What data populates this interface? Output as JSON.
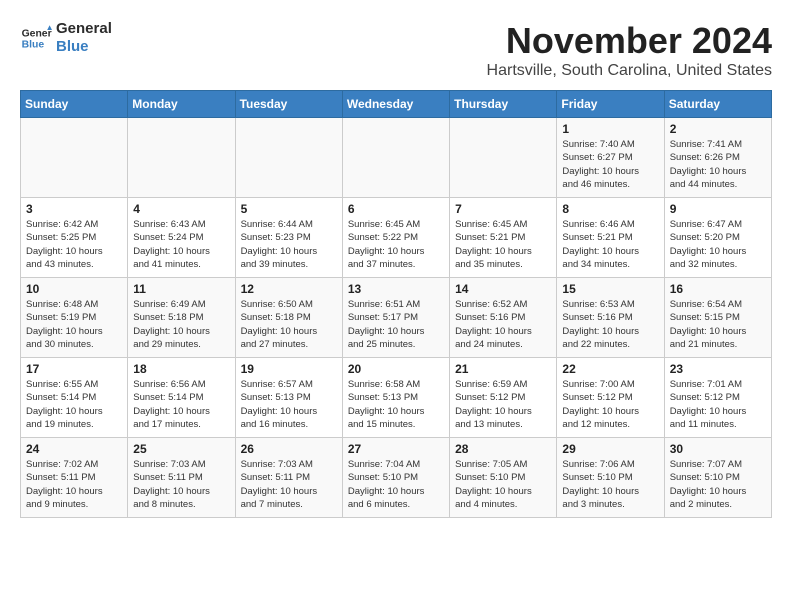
{
  "logo": {
    "line1": "General",
    "line2": "Blue"
  },
  "title": "November 2024",
  "location": "Hartsville, South Carolina, United States",
  "days_of_week": [
    "Sunday",
    "Monday",
    "Tuesday",
    "Wednesday",
    "Thursday",
    "Friday",
    "Saturday"
  ],
  "weeks": [
    [
      {
        "day": "",
        "info": ""
      },
      {
        "day": "",
        "info": ""
      },
      {
        "day": "",
        "info": ""
      },
      {
        "day": "",
        "info": ""
      },
      {
        "day": "",
        "info": ""
      },
      {
        "day": "1",
        "info": "Sunrise: 7:40 AM\nSunset: 6:27 PM\nDaylight: 10 hours\nand 46 minutes."
      },
      {
        "day": "2",
        "info": "Sunrise: 7:41 AM\nSunset: 6:26 PM\nDaylight: 10 hours\nand 44 minutes."
      }
    ],
    [
      {
        "day": "3",
        "info": "Sunrise: 6:42 AM\nSunset: 5:25 PM\nDaylight: 10 hours\nand 43 minutes."
      },
      {
        "day": "4",
        "info": "Sunrise: 6:43 AM\nSunset: 5:24 PM\nDaylight: 10 hours\nand 41 minutes."
      },
      {
        "day": "5",
        "info": "Sunrise: 6:44 AM\nSunset: 5:23 PM\nDaylight: 10 hours\nand 39 minutes."
      },
      {
        "day": "6",
        "info": "Sunrise: 6:45 AM\nSunset: 5:22 PM\nDaylight: 10 hours\nand 37 minutes."
      },
      {
        "day": "7",
        "info": "Sunrise: 6:45 AM\nSunset: 5:21 PM\nDaylight: 10 hours\nand 35 minutes."
      },
      {
        "day": "8",
        "info": "Sunrise: 6:46 AM\nSunset: 5:21 PM\nDaylight: 10 hours\nand 34 minutes."
      },
      {
        "day": "9",
        "info": "Sunrise: 6:47 AM\nSunset: 5:20 PM\nDaylight: 10 hours\nand 32 minutes."
      }
    ],
    [
      {
        "day": "10",
        "info": "Sunrise: 6:48 AM\nSunset: 5:19 PM\nDaylight: 10 hours\nand 30 minutes."
      },
      {
        "day": "11",
        "info": "Sunrise: 6:49 AM\nSunset: 5:18 PM\nDaylight: 10 hours\nand 29 minutes."
      },
      {
        "day": "12",
        "info": "Sunrise: 6:50 AM\nSunset: 5:18 PM\nDaylight: 10 hours\nand 27 minutes."
      },
      {
        "day": "13",
        "info": "Sunrise: 6:51 AM\nSunset: 5:17 PM\nDaylight: 10 hours\nand 25 minutes."
      },
      {
        "day": "14",
        "info": "Sunrise: 6:52 AM\nSunset: 5:16 PM\nDaylight: 10 hours\nand 24 minutes."
      },
      {
        "day": "15",
        "info": "Sunrise: 6:53 AM\nSunset: 5:16 PM\nDaylight: 10 hours\nand 22 minutes."
      },
      {
        "day": "16",
        "info": "Sunrise: 6:54 AM\nSunset: 5:15 PM\nDaylight: 10 hours\nand 21 minutes."
      }
    ],
    [
      {
        "day": "17",
        "info": "Sunrise: 6:55 AM\nSunset: 5:14 PM\nDaylight: 10 hours\nand 19 minutes."
      },
      {
        "day": "18",
        "info": "Sunrise: 6:56 AM\nSunset: 5:14 PM\nDaylight: 10 hours\nand 17 minutes."
      },
      {
        "day": "19",
        "info": "Sunrise: 6:57 AM\nSunset: 5:13 PM\nDaylight: 10 hours\nand 16 minutes."
      },
      {
        "day": "20",
        "info": "Sunrise: 6:58 AM\nSunset: 5:13 PM\nDaylight: 10 hours\nand 15 minutes."
      },
      {
        "day": "21",
        "info": "Sunrise: 6:59 AM\nSunset: 5:12 PM\nDaylight: 10 hours\nand 13 minutes."
      },
      {
        "day": "22",
        "info": "Sunrise: 7:00 AM\nSunset: 5:12 PM\nDaylight: 10 hours\nand 12 minutes."
      },
      {
        "day": "23",
        "info": "Sunrise: 7:01 AM\nSunset: 5:12 PM\nDaylight: 10 hours\nand 11 minutes."
      }
    ],
    [
      {
        "day": "24",
        "info": "Sunrise: 7:02 AM\nSunset: 5:11 PM\nDaylight: 10 hours\nand 9 minutes."
      },
      {
        "day": "25",
        "info": "Sunrise: 7:03 AM\nSunset: 5:11 PM\nDaylight: 10 hours\nand 8 minutes."
      },
      {
        "day": "26",
        "info": "Sunrise: 7:03 AM\nSunset: 5:11 PM\nDaylight: 10 hours\nand 7 minutes."
      },
      {
        "day": "27",
        "info": "Sunrise: 7:04 AM\nSunset: 5:10 PM\nDaylight: 10 hours\nand 6 minutes."
      },
      {
        "day": "28",
        "info": "Sunrise: 7:05 AM\nSunset: 5:10 PM\nDaylight: 10 hours\nand 4 minutes."
      },
      {
        "day": "29",
        "info": "Sunrise: 7:06 AM\nSunset: 5:10 PM\nDaylight: 10 hours\nand 3 minutes."
      },
      {
        "day": "30",
        "info": "Sunrise: 7:07 AM\nSunset: 5:10 PM\nDaylight: 10 hours\nand 2 minutes."
      }
    ]
  ]
}
